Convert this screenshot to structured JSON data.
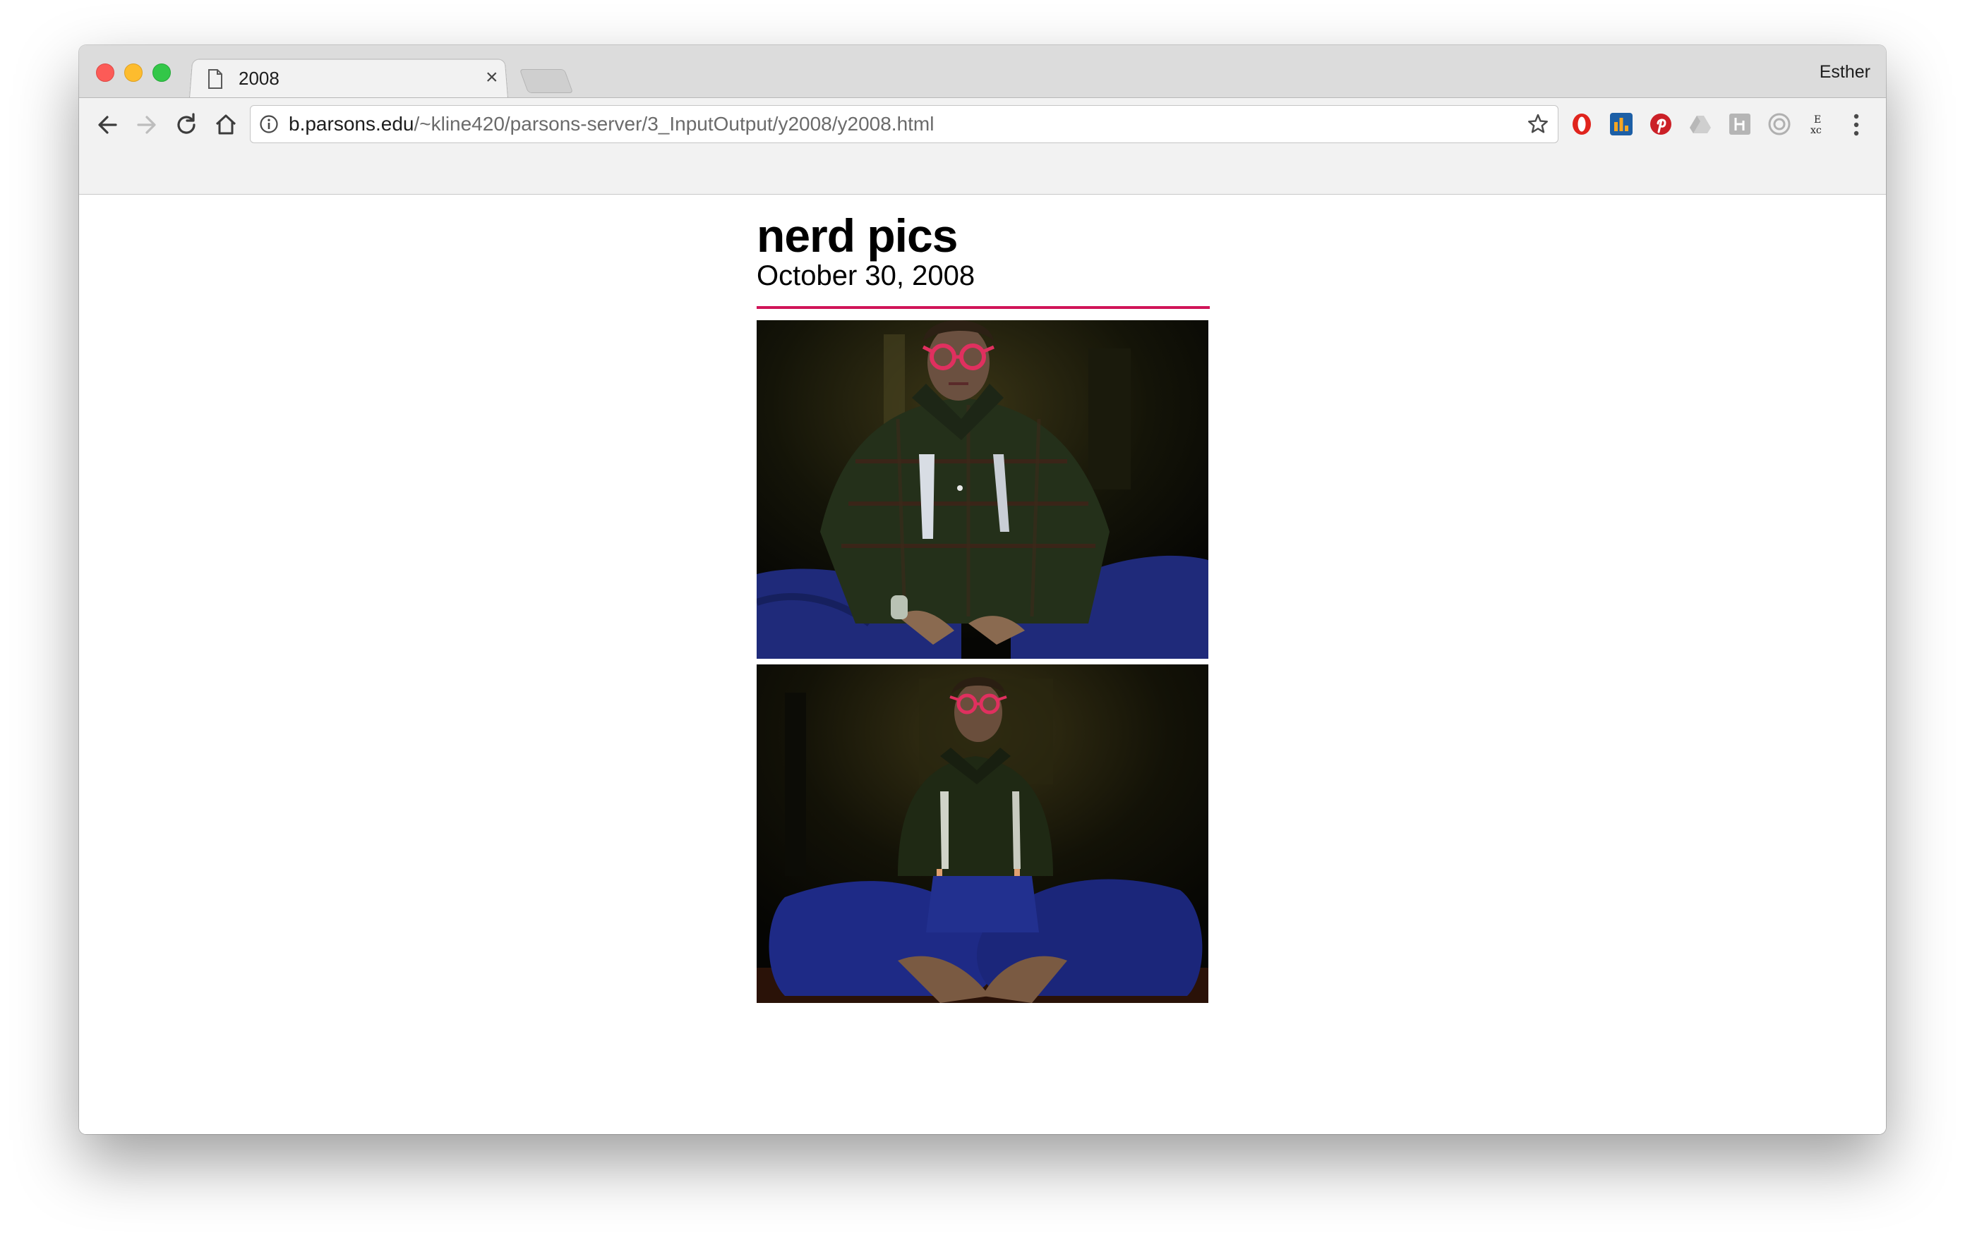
{
  "browser": {
    "tab": {
      "title": "2008",
      "icon": "document-icon",
      "close": "×"
    },
    "profile_name": "Esther",
    "url_host": "b.parsons.edu",
    "url_path": "/~kline420/parsons-server/3_InputOutput/y2008/y2008.html",
    "extensions": [
      "opera-extension",
      "analytics-extension",
      "pinterest-extension",
      "drive-extension",
      "h-extension",
      "circle-extension",
      "dictionary-extension"
    ]
  },
  "page": {
    "title": "nerd pics",
    "date": "October 30, 2008",
    "accent_color": "#d01458",
    "photos": [
      {
        "name": "photo-1",
        "icon": "photo-person-glasses-suspenders"
      },
      {
        "name": "photo-2",
        "icon": "photo-person-sitting-cross-legged"
      }
    ]
  }
}
